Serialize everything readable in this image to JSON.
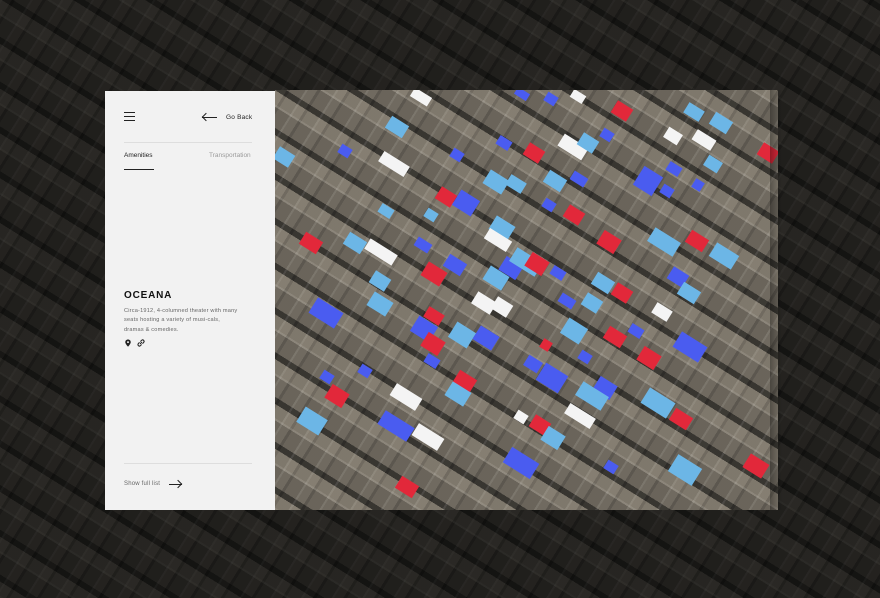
{
  "nav": {
    "go_back_label": "Go Back"
  },
  "tabs": [
    {
      "label": "Amenities",
      "active": true
    },
    {
      "label": "Transportation",
      "active": false
    }
  ],
  "place": {
    "title": "OCEANA",
    "description": "Circa-1912, 4-columned theater with many seats hosting a variety of musi-cals, dramas & comedies."
  },
  "footer": {
    "show_full_label": "Show full list"
  },
  "icons": {
    "menu": "hamburger-menu-icon",
    "back": "arrow-left-icon",
    "pin": "map-pin-icon",
    "link": "link-icon",
    "forward": "arrow-right-icon"
  },
  "colors": {
    "panel_bg": "#f2f2f2",
    "marker_white": "#f4f4f4",
    "marker_blue": "#4a5cf0",
    "marker_red": "#e2283a",
    "marker_light_blue": "#6cb6e6"
  }
}
